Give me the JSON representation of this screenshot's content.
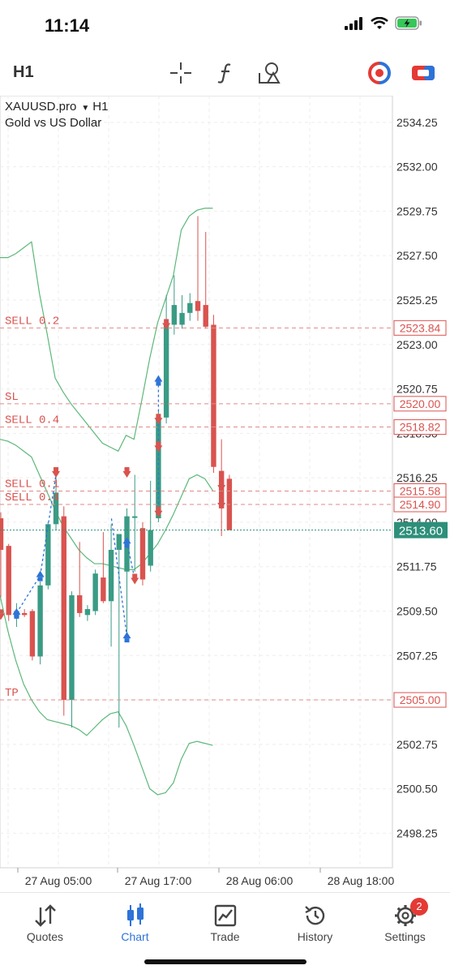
{
  "status": {
    "time": "11:14"
  },
  "toolbar": {
    "timeframe": "H1"
  },
  "chart": {
    "symbol": "XAUUSD.pro",
    "symbol_timeframe": "H1",
    "description": "Gold vs US Dollar",
    "colors": {
      "bull": "#3a9b84",
      "bear": "#d9534f",
      "band": "#5cb87a",
      "price_line": "#2d8f7a"
    }
  },
  "chart_data": {
    "type": "candlestick",
    "ylim": [
      2496.5,
      2535.6
    ],
    "y_ticks": [
      "2534.25",
      "2532.00",
      "2529.75",
      "2527.50",
      "2525.25",
      "2523.00",
      "2520.75",
      "2518.50",
      "2516.25",
      "2514.00",
      "2511.75",
      "2509.50",
      "2507.25",
      "2505.00",
      "2502.75",
      "2500.50",
      "2498.25"
    ],
    "x_ticks": [
      "27 Aug 05:00",
      "27 Aug 17:00",
      "28 Aug 06:00",
      "28 Aug 18:00"
    ],
    "candles": [
      {
        "o": 2514.2,
        "h": 2514.5,
        "l": 2510.2,
        "c": 2512.6
      },
      {
        "o": 2512.8,
        "h": 2512.9,
        "l": 2509.0,
        "c": 2509.3
      },
      {
        "o": 2509.2,
        "h": 2509.9,
        "l": 2508.7,
        "c": 2509.5
      },
      {
        "o": 2509.4,
        "h": 2509.6,
        "l": 2509.2,
        "c": 2509.3
      },
      {
        "o": 2509.5,
        "h": 2509.6,
        "l": 2507.0,
        "c": 2507.2
      },
      {
        "o": 2507.2,
        "h": 2511.0,
        "l": 2506.8,
        "c": 2510.8
      },
      {
        "o": 2510.8,
        "h": 2514.0,
        "l": 2510.6,
        "c": 2513.9
      },
      {
        "o": 2513.9,
        "h": 2516.5,
        "l": 2513.6,
        "c": 2515.5
      },
      {
        "o": 2514.3,
        "h": 2514.8,
        "l": 2504.2,
        "c": 2505.0
      },
      {
        "o": 2505.0,
        "h": 2510.5,
        "l": 2503.6,
        "c": 2510.3
      },
      {
        "o": 2510.3,
        "h": 2513.0,
        "l": 2509.2,
        "c": 2509.4
      },
      {
        "o": 2509.3,
        "h": 2509.8,
        "l": 2509.0,
        "c": 2509.6
      },
      {
        "o": 2509.5,
        "h": 2511.6,
        "l": 2509.3,
        "c": 2511.4
      },
      {
        "o": 2511.2,
        "h": 2513.5,
        "l": 2509.9,
        "c": 2510.0
      },
      {
        "o": 2510.0,
        "h": 2513.9,
        "l": 2507.7,
        "c": 2512.6
      },
      {
        "o": 2512.6,
        "h": 2512.8,
        "l": 2503.6,
        "c": 2513.4
      },
      {
        "o": 2511.5,
        "h": 2514.7,
        "l": 2508.2,
        "c": 2514.3
      },
      {
        "o": 2514.3,
        "h": 2516.4,
        "l": 2511.5,
        "c": 2514.3
      },
      {
        "o": 2513.7,
        "h": 2514.0,
        "l": 2510.8,
        "c": 2511.1
      },
      {
        "o": 2511.8,
        "h": 2516.1,
        "l": 2511.5,
        "c": 2513.6
      },
      {
        "o": 2514.2,
        "h": 2519.6,
        "l": 2514.0,
        "c": 2519.3
      },
      {
        "o": 2519.3,
        "h": 2525.5,
        "l": 2519.0,
        "c": 2524.0
      },
      {
        "o": 2524.0,
        "h": 2526.5,
        "l": 2523.5,
        "c": 2525.0
      },
      {
        "o": 2524.0,
        "h": 2525.5,
        "l": 2523.8,
        "c": 2524.6
      },
      {
        "o": 2524.6,
        "h": 2525.6,
        "l": 2524.2,
        "c": 2525.1
      },
      {
        "o": 2525.2,
        "h": 2529.5,
        "l": 2524.2,
        "c": 2524.7
      },
      {
        "o": 2525.0,
        "h": 2528.7,
        "l": 2523.8,
        "c": 2523.9
      },
      {
        "o": 2524.0,
        "h": 2524.5,
        "l": 2516.5,
        "c": 2516.8
      },
      {
        "o": 2516.6,
        "h": 2518.2,
        "l": 2513.3,
        "c": 2514.7
      },
      {
        "o": 2516.2,
        "h": 2516.4,
        "l": 2513.6,
        "c": 2513.6
      }
    ],
    "bands": {
      "upper": [
        2527.4,
        2527.4,
        2527.6,
        2527.9,
        2528.2,
        2525.6,
        2523.5,
        2521.3,
        2520.6,
        2520.0,
        2519.5,
        2519.0,
        2518.5,
        2518.0,
        2517.8,
        2517.6,
        2518.4,
        2518.2,
        2520.2,
        2522.3,
        2524.1,
        2525.3,
        2526.5,
        2528.8,
        2529.5,
        2529.8,
        2529.9,
        2529.9
      ],
      "middle": [
        2518.2,
        2518.1,
        2517.9,
        2517.6,
        2517.3,
        2516.4,
        2515.5,
        2514.6,
        2513.8,
        2513.2,
        2512.6,
        2512.2,
        2511.9,
        2511.9,
        2511.8,
        2511.7,
        2511.6,
        2511.6,
        2511.9,
        2512.4,
        2512.9,
        2513.6,
        2514.4,
        2515.3,
        2516.2,
        2516.4,
        2516.2,
        2515.6
      ],
      "lower": [
        2510.3,
        2508.5,
        2507.0,
        2505.8,
        2505.0,
        2504.4,
        2504.0,
        2503.9,
        2503.8,
        2503.7,
        2503.5,
        2503.2,
        2503.6,
        2504.0,
        2504.3,
        2504.4,
        2503.7,
        2502.7,
        2501.6,
        2500.5,
        2500.2,
        2500.3,
        2500.8,
        2502.0,
        2502.8,
        2502.9,
        2502.8,
        2502.7
      ]
    },
    "hlines": [
      {
        "label": "SELL 0.2",
        "price": 2523.84,
        "tag": "2523.84",
        "kind": "order"
      },
      {
        "label": "SL",
        "price": 2520.0,
        "tag": "2520.00",
        "kind": "order"
      },
      {
        "label": "SELL 0.4",
        "price": 2518.82,
        "tag": "2518.82",
        "kind": "order"
      },
      {
        "label": "SELL 0.1",
        "price": 2515.58,
        "tag": "2515.58",
        "kind": "order"
      },
      {
        "label": "SELL 0.4",
        "price": 2514.9,
        "tag": "2514.90",
        "kind": "order"
      },
      {
        "label": "",
        "price": 2513.6,
        "tag": "2513.60",
        "kind": "current"
      },
      {
        "label": "TP",
        "price": 2505.0,
        "tag": "2505.00",
        "kind": "order"
      }
    ],
    "trades": [
      {
        "kind": "buy",
        "i1": 2,
        "p1": 2509.4,
        "i2": 5,
        "p2": 2511.3
      },
      {
        "kind": "buy",
        "i1": 5,
        "p1": 2511.3,
        "i2": 7,
        "p2": 2516.4
      },
      {
        "kind": "buy",
        "i1": 16,
        "p1": 2508.2,
        "i2": 14,
        "p2": 2514.3
      },
      {
        "kind": "buy",
        "i1": 16,
        "p1": 2513.0,
        "i2": 17,
        "p2": 2511.1
      },
      {
        "kind": "buy",
        "i1": 20,
        "p1": 2521.2,
        "i2": 20,
        "p2": 2514.4
      },
      {
        "kind": "sell",
        "i1": 21,
        "p1": 2524.0,
        "i2": 21,
        "p2": 2524.0
      },
      {
        "kind": "sell",
        "i1": 16,
        "p1": 2516.5,
        "i2": 16,
        "p2": 2516.5
      },
      {
        "kind": "sell",
        "i1": 20,
        "p1": 2519.2,
        "i2": 20,
        "p2": 2519.2
      },
      {
        "kind": "sell",
        "i1": 20,
        "p1": 2517.8,
        "i2": 20,
        "p2": 2517.8
      },
      {
        "kind": "sell",
        "i1": 20,
        "p1": 2514.5,
        "i2": 20,
        "p2": 2514.5
      },
      {
        "kind": "sell",
        "i1": 28,
        "p1": 2515.8,
        "i2": 28,
        "p2": 2515.8
      },
      {
        "kind": "sell",
        "i1": 28,
        "p1": 2514.9,
        "i2": 28,
        "p2": 2514.9
      },
      {
        "kind": "sell",
        "i1": 0,
        "p1": 2509.3,
        "i2": 0,
        "p2": 2509.3
      },
      {
        "kind": "sell",
        "i1": 7,
        "p1": 2516.5,
        "i2": 7,
        "p2": 2516.5
      },
      {
        "kind": "sell",
        "i1": 17,
        "p1": 2511.1,
        "i2": 17,
        "p2": 2511.1
      }
    ]
  },
  "tabs": [
    {
      "label": "Quotes",
      "icon": "quotes-arrows-icon",
      "active": false
    },
    {
      "label": "Chart",
      "icon": "candlestick-icon",
      "active": true
    },
    {
      "label": "Trade",
      "icon": "trade-chart-icon",
      "active": false
    },
    {
      "label": "History",
      "icon": "history-clock-icon",
      "active": false
    },
    {
      "label": "Settings",
      "icon": "gear-icon",
      "active": false,
      "badge": "2"
    }
  ]
}
